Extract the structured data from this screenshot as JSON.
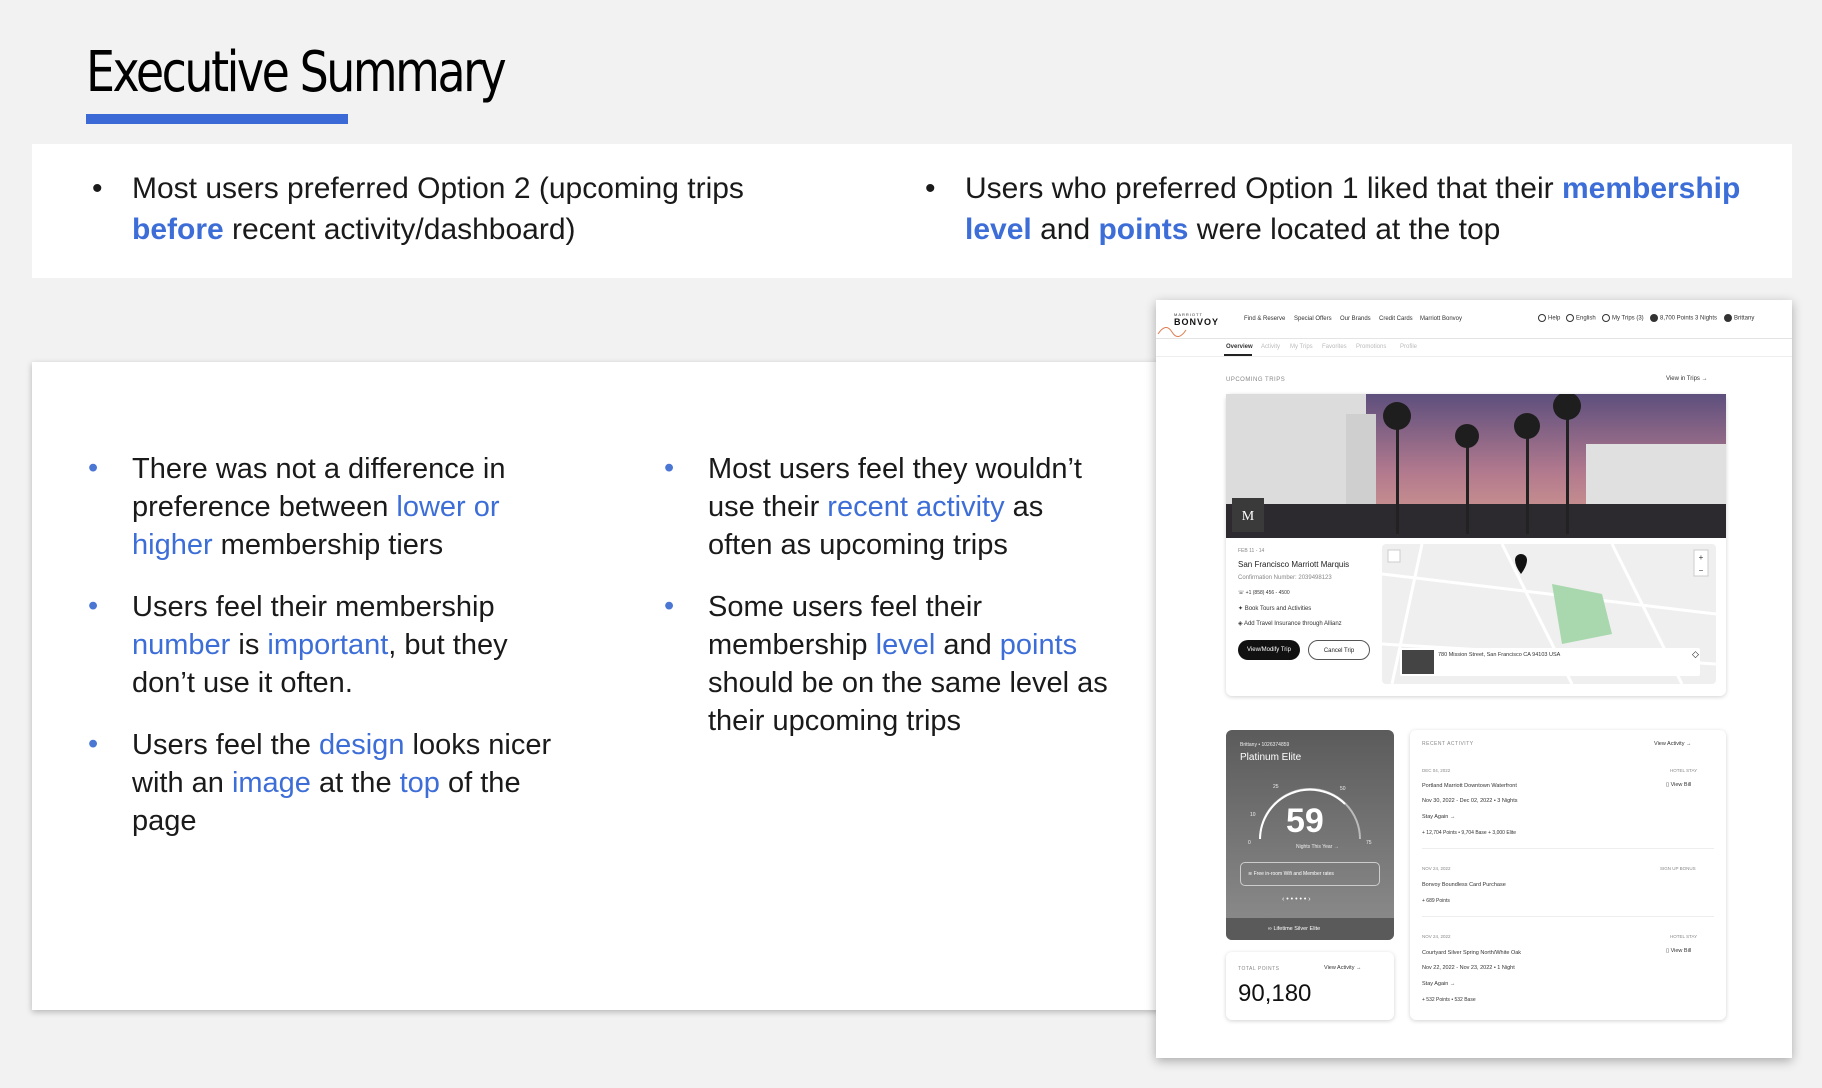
{
  "title": "Executive Summary",
  "top": {
    "left": {
      "a": "Most users preferred Option 2 (upcoming trips ",
      "b": "before",
      "c": " recent activity/dashboard)"
    },
    "right": {
      "a": "Users who preferred Option 1 liked that their ",
      "b": "membership level",
      "c": " and ",
      "d": "points",
      "e": " were located at the top"
    }
  },
  "bullet_char": "•",
  "left_col": [
    {
      "a": "There was not a difference in preference between ",
      "b": "lower or higher",
      "c": " membership tiers"
    },
    {
      "a": "Users feel their membership ",
      "b": "number",
      "c": " is ",
      "d": "important",
      "e": ", but they don’t use it often."
    },
    {
      "a": "Users feel the ",
      "b": "design",
      "c": " looks nicer with an ",
      "d": "image",
      "e": " at the ",
      "f": "top",
      "g": " of the page"
    }
  ],
  "right_col": [
    {
      "a": "Most users feel they wouldn’t use their ",
      "b": "recent activity",
      "c": " as often as upcoming trips"
    },
    {
      "a": "Some users feel their membership ",
      "b": "level",
      "c": " and ",
      "d": "points",
      "e": " should be on the same level as their upcoming trips"
    }
  ],
  "mock": {
    "logo_top": "MARRIOTT",
    "logo": "BONVOY",
    "nav": [
      "Find & Reserve",
      "Special Offers",
      "Our Brands",
      "Credit Cards",
      "Marriott Bonvoy"
    ],
    "util": [
      "Help",
      "English",
      "My Trips (3)",
      "8,700 Points 3 Nights",
      "Brittany"
    ],
    "tabs": [
      "Overview",
      "Activity",
      "My Trips",
      "Favorites",
      "Promotions",
      "Profile"
    ],
    "upcoming_label": "UPCOMING TRIPS",
    "view_trips": "View in Trips →",
    "trip_dates": "FEB 11 - 14",
    "hotel": "San Francisco Marriott Marquis",
    "confirmation": "Confirmation Number: 2039498123",
    "phone": "+1 (858) 456 - 4500",
    "tours": "Book Tours and Activities",
    "insurance": "Add Travel Insurance through Allianz",
    "btn_modify": "View/Modify Trip",
    "btn_cancel": "Cancel Trip",
    "address": "780 Mission Street, San Francisco CA 94103 USA",
    "member_name": "Brittany • 1026374859",
    "tier": "Platinum Elite",
    "gauge_ticks": [
      "0",
      "10",
      "25",
      "50",
      "75"
    ],
    "nights": "59",
    "nights_label": "Nights This Year →",
    "benefit": "Free in-room Wifi and Member rates",
    "lifetime": "Lifetime Silver Elite",
    "carousel": "‹ • • • • • ›",
    "total_points_label": "TOTAL POINTS",
    "view_activity": "View Activity →",
    "total_points": "90,180",
    "recent_label": "RECENT ACTIVITY",
    "activities": [
      {
        "date": "DEC 04, 2022",
        "type": "HOTEL STAY",
        "name": "Portland Marriott Downtown Waterfront",
        "sub": "Nov 30, 2022 - Dec 02, 2022 • 3 Nights",
        "cta": "Stay Again →",
        "points": "+ 12,704 Points • 9,704 Base + 3,000 Elite",
        "bill": "View Bill"
      },
      {
        "date": "NOV 24, 2022",
        "type": "SIGN UP BONUS",
        "name": "Bonvoy Boundless Card Purchase",
        "sub": "",
        "cta": "",
        "points": "+ 689 Points",
        "bill": ""
      },
      {
        "date": "NOV 24, 2022",
        "type": "HOTEL STAY",
        "name": "Courtyard Silver Spring North/White Oak",
        "sub": "Nov 22, 2022 - Nov 23, 2022 • 1 Night",
        "cta": "Stay Again →",
        "points": "+ 532 Points • 532 Base",
        "bill": "View Bill"
      }
    ]
  },
  "colors": {
    "accent": "#3d6ed8",
    "underline": "#3b69d6"
  }
}
